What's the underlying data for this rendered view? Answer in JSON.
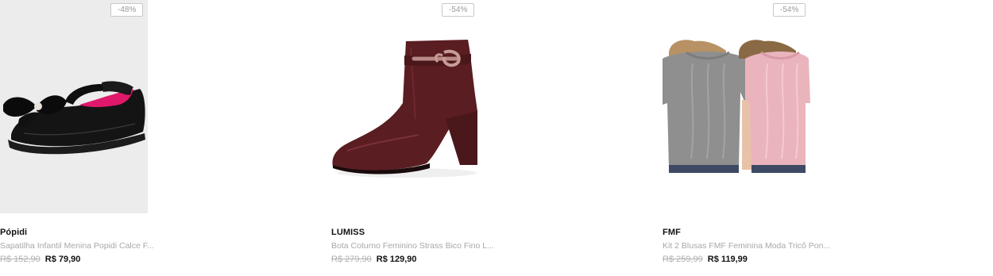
{
  "products": [
    {
      "discount": "-48%",
      "brand": "Pópidi",
      "title": "Sapatilha Infantil Menina Popidi Calce F...",
      "old_price": "R$ 152,90",
      "new_price": "R$ 79,90",
      "image": "black-flat-shoe-with-bow"
    },
    {
      "discount": "-54%",
      "brand": "LUMISS",
      "title": "Bota Coturno Feminino Strass Bico Fino L...",
      "old_price": "R$ 279,90",
      "new_price": "R$ 129,90",
      "image": "burgundy-ankle-boot"
    },
    {
      "discount": "-54%",
      "brand": "FMF",
      "title": "Kit 2 Blusas FMF Feminina Moda Tricô Pon...",
      "old_price": "R$ 259,99",
      "new_price": "R$ 119,99",
      "image": "grey-and-pink-knit-blouses"
    }
  ],
  "colors": {
    "text": "#111111",
    "muted": "#a8a8a8",
    "badge_border": "#c8c8c8"
  }
}
